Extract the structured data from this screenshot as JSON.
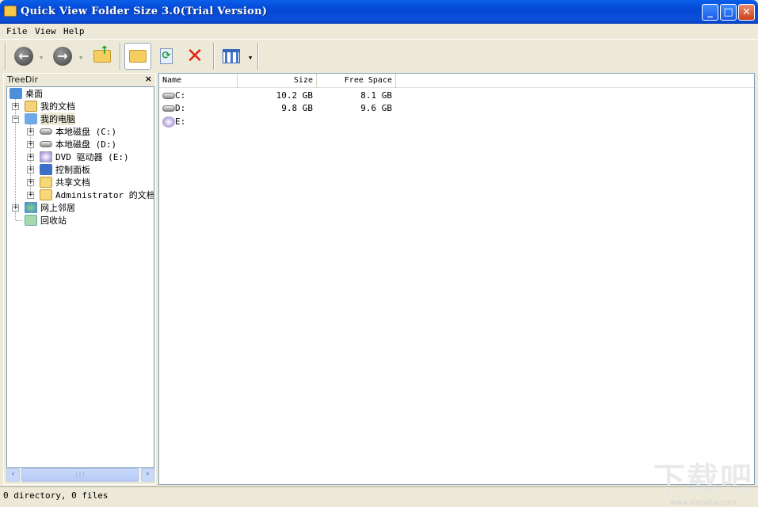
{
  "window": {
    "title": "Quick View Folder Size 3.0(Trial Version)",
    "minimize": "_",
    "maximize": "□",
    "close": "✕"
  },
  "menu": [
    {
      "label": "File"
    },
    {
      "label": "View"
    },
    {
      "label": "Help"
    }
  ],
  "toolbar": {
    "back": "back-icon",
    "forward": "forward-icon",
    "up": "up-folder-icon",
    "open": "open-folder-icon",
    "refresh": "refresh-icon",
    "delete": "delete-icon",
    "view": "view-icon"
  },
  "tree_panel": {
    "title": "TreeDir",
    "close": "×",
    "items": [
      {
        "label": "桌面",
        "level": 0
      },
      {
        "label": "我的文档",
        "level": 1
      },
      {
        "label": "我的电脑",
        "level": 1
      },
      {
        "label": "本地磁盘 (C:)",
        "level": 2
      },
      {
        "label": "本地磁盘 (D:)",
        "level": 2
      },
      {
        "label": "DVD 驱动器 (E:)",
        "level": 2
      },
      {
        "label": "控制面板",
        "level": 2
      },
      {
        "label": "共享文档",
        "level": 2
      },
      {
        "label": "Administrator 的文档",
        "level": 2
      },
      {
        "label": "网上邻居",
        "level": 1
      },
      {
        "label": "回收站",
        "level": 1
      }
    ]
  },
  "list": {
    "columns": [
      "Name",
      "Size",
      "Free Space"
    ],
    "rows": [
      {
        "name": "C:",
        "size": "10.2 GB",
        "free": "8.1 GB"
      },
      {
        "name": "D:",
        "size": "9.8 GB",
        "free": "9.6 GB"
      },
      {
        "name": "E:",
        "size": "",
        "free": ""
      }
    ]
  },
  "status": "0 directory, 0 files",
  "watermark": {
    "logo": "下载吧",
    "url": "www.xiazaiba.com"
  }
}
